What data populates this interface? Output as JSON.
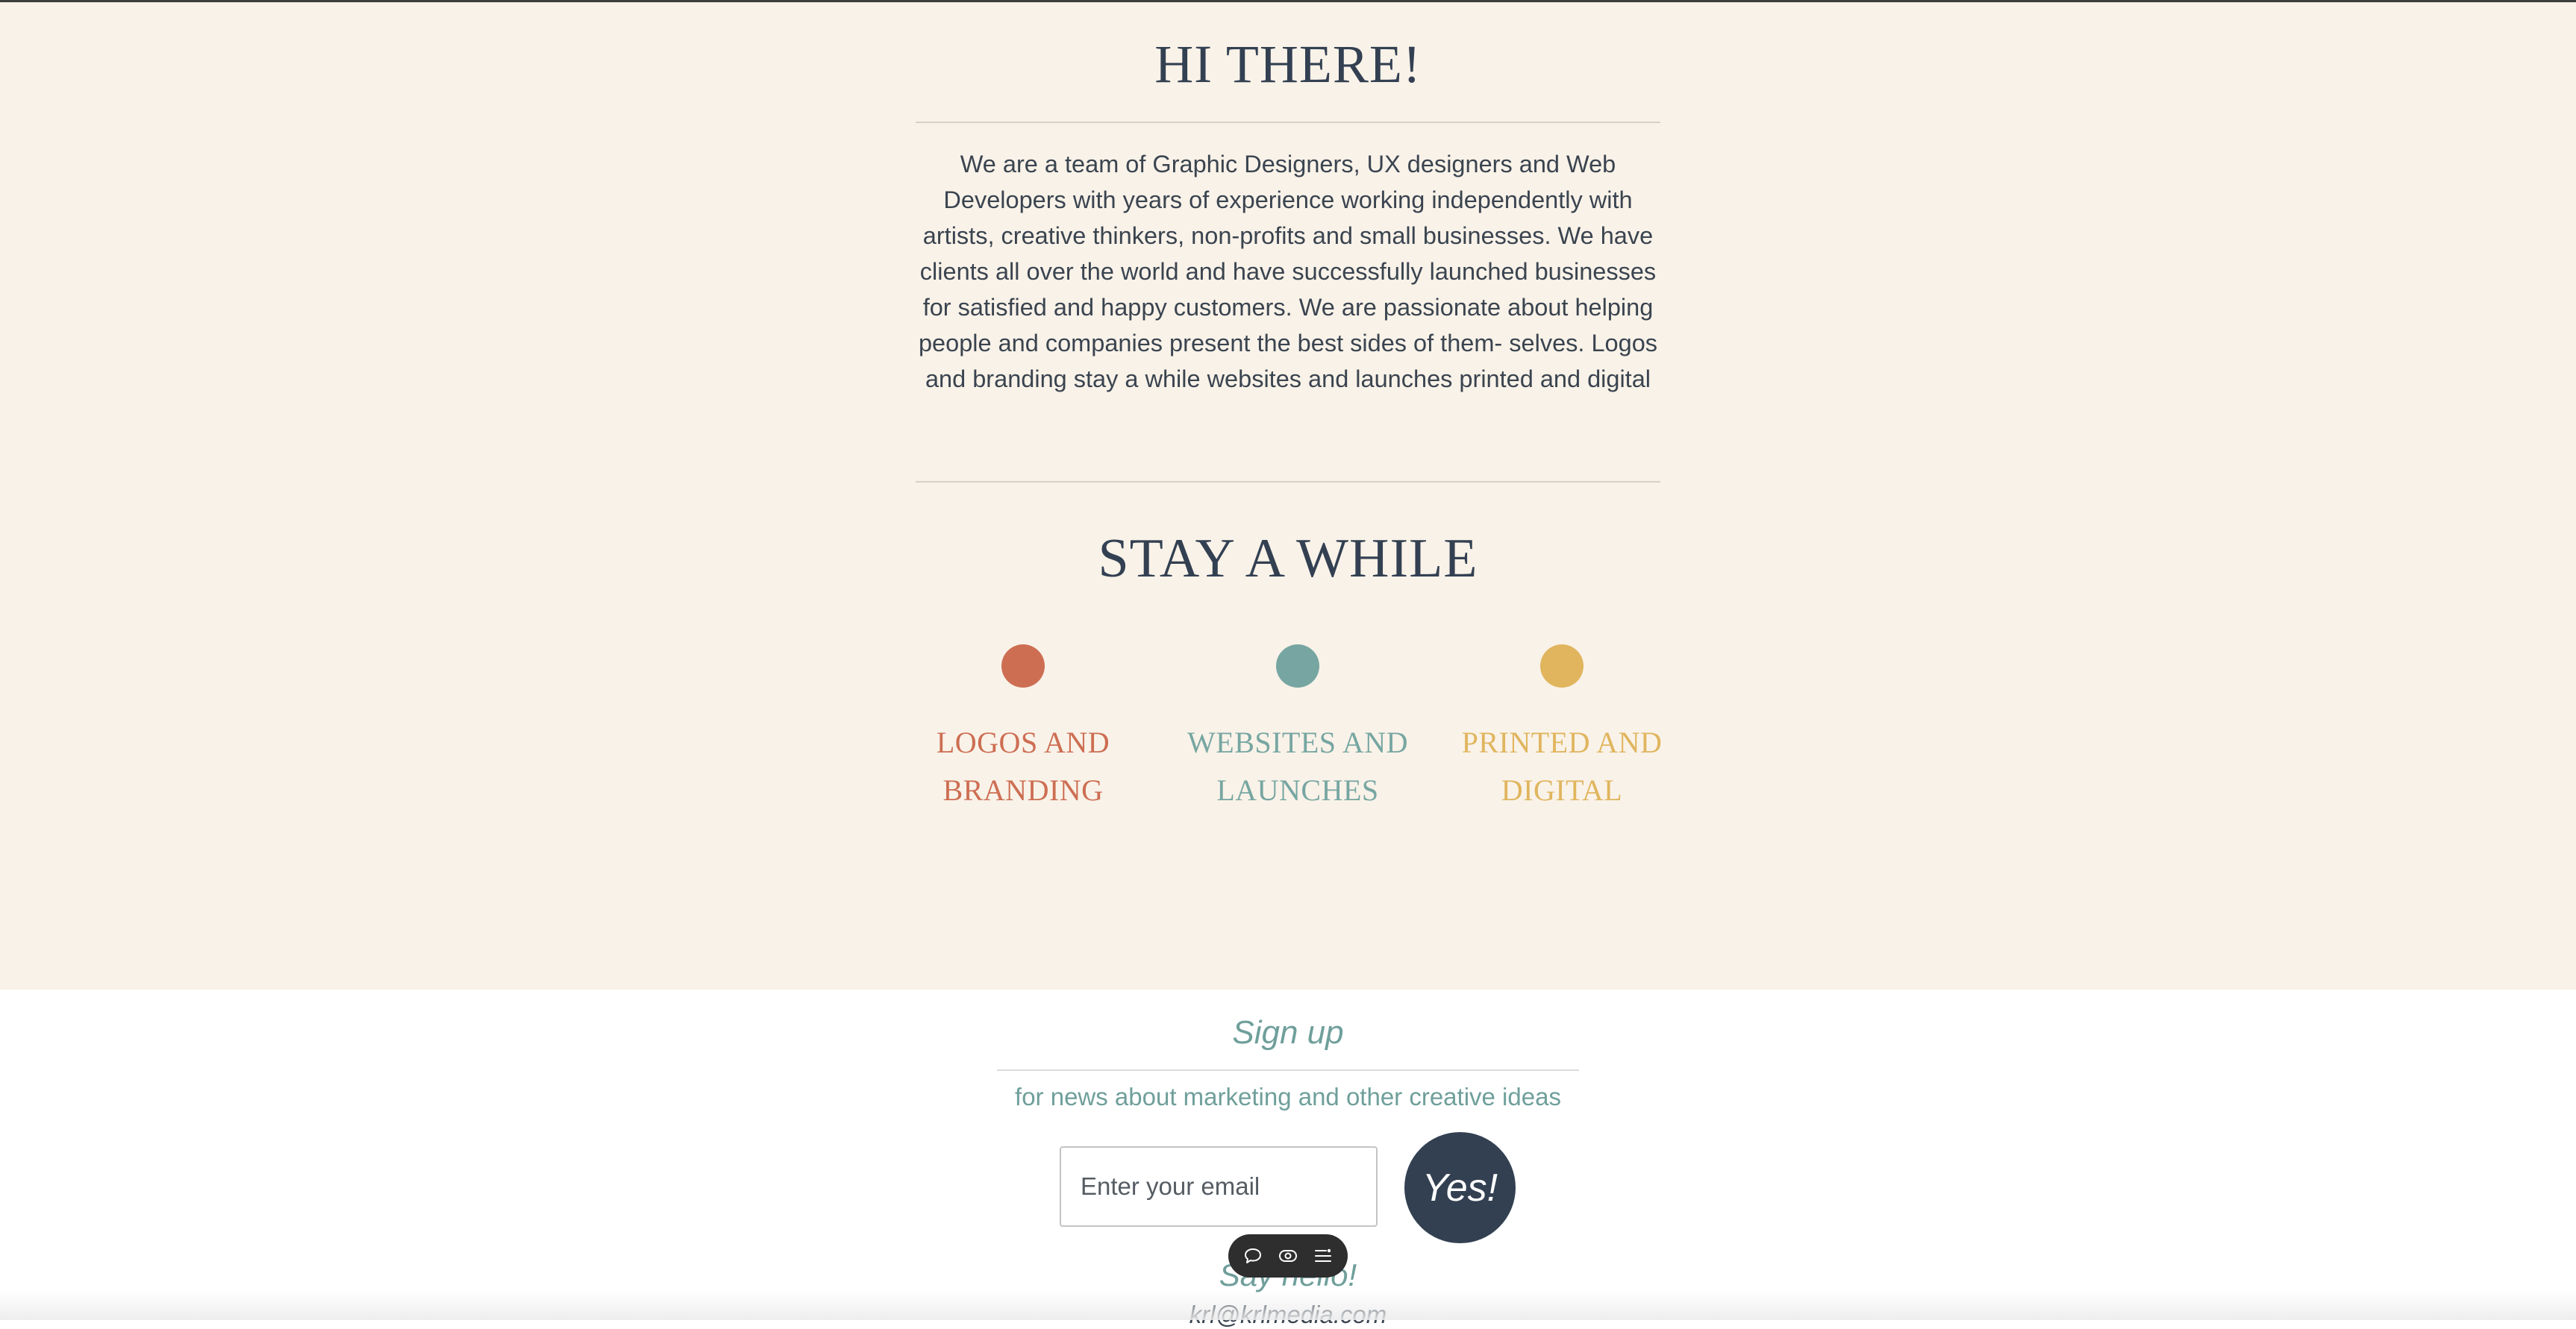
{
  "hero": {
    "title": "HI THERE!",
    "intro": "We are a team of Graphic Designers, UX designers and Web Developers with years of experience working independently with artists, creative thinkers, non-profits and small businesses. We have clients all over the world and have successfully launched businesses for satisfied and happy customers. We are passionate about helping people and companies present the best sides of them- selves. Logos and branding stay a while websites and launches printed and digital"
  },
  "services": {
    "title": "STAY A WHILE",
    "items": [
      {
        "line1": "LOGOS AND",
        "line2": "BRANDING",
        "color": "#cd6e53"
      },
      {
        "line1": "WEBSITES AND",
        "line2": "LAUNCHES",
        "color": "#77a6a2"
      },
      {
        "line1": "PRINTED AND",
        "line2": "DIGITAL",
        "color": "#e0b55e"
      }
    ]
  },
  "signup": {
    "title": "Sign up",
    "subtitle": "for news about marketing and other creative ideas",
    "email_placeholder": "Enter your email",
    "submit_label": "Yes!"
  },
  "contact": {
    "title": "Say hello!",
    "email": "krl@krlmedia.com"
  },
  "toolbar": {
    "icons": [
      "comment-icon",
      "eye-icon",
      "menu-settings-icon"
    ]
  },
  "colors": {
    "hero_bg": "#f9f2e8",
    "heading": "#334052",
    "teal": "#6f9f9b",
    "button": "#334052"
  }
}
